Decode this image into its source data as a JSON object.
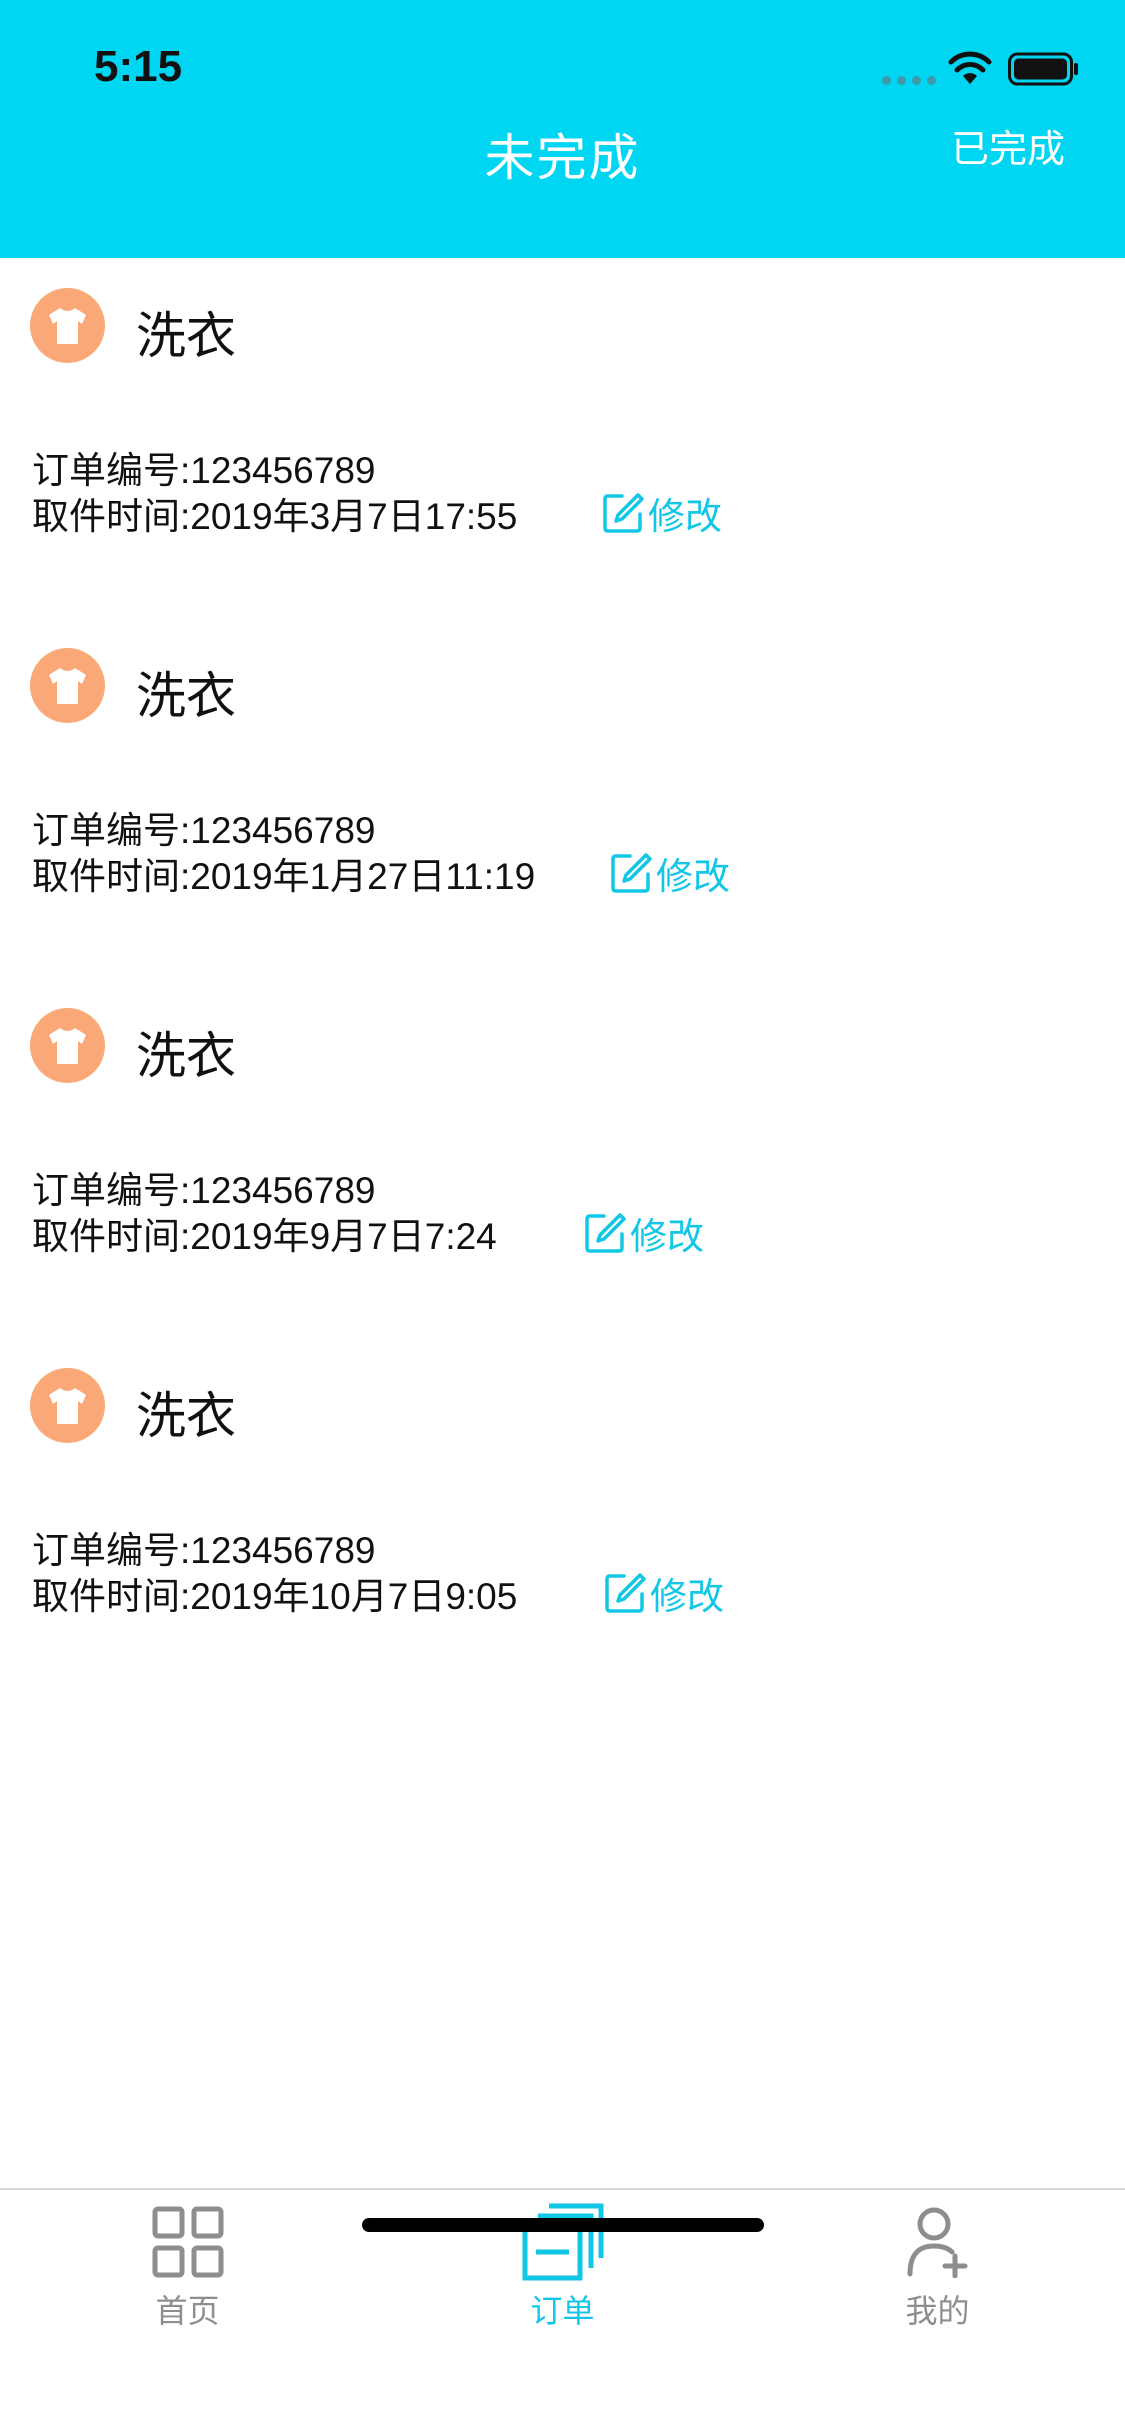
{
  "status_bar": {
    "time": "5:15"
  },
  "header": {
    "title": "未完成",
    "action_label": "已完成"
  },
  "orders": [
    {
      "service": "洗衣",
      "order_no": "订单编号:123456789",
      "pickup_time": "取件时间:2019年3月7日17:55",
      "edit_label": "修改"
    },
    {
      "service": "洗衣",
      "order_no": "订单编号:123456789",
      "pickup_time": "取件时间:2019年1月27日11:19",
      "edit_label": "修改"
    },
    {
      "service": "洗衣",
      "order_no": "订单编号:123456789",
      "pickup_time": "取件时间:2019年9月7日7:24",
      "edit_label": "修改"
    },
    {
      "service": "洗衣",
      "order_no": "订单编号:123456789",
      "pickup_time": "取件时间:2019年10月7日9:05",
      "edit_label": "修改"
    }
  ],
  "tabbar": {
    "items": [
      {
        "label": "首页",
        "icon": "grid-icon",
        "active": false
      },
      {
        "label": "订单",
        "icon": "layers-icon",
        "active": true
      },
      {
        "label": "我的",
        "icon": "user-add-icon",
        "active": false
      }
    ]
  },
  "colors": {
    "accent": "#00d5f1",
    "link": "#12c7e6",
    "service_icon_bg": "#fba878"
  }
}
